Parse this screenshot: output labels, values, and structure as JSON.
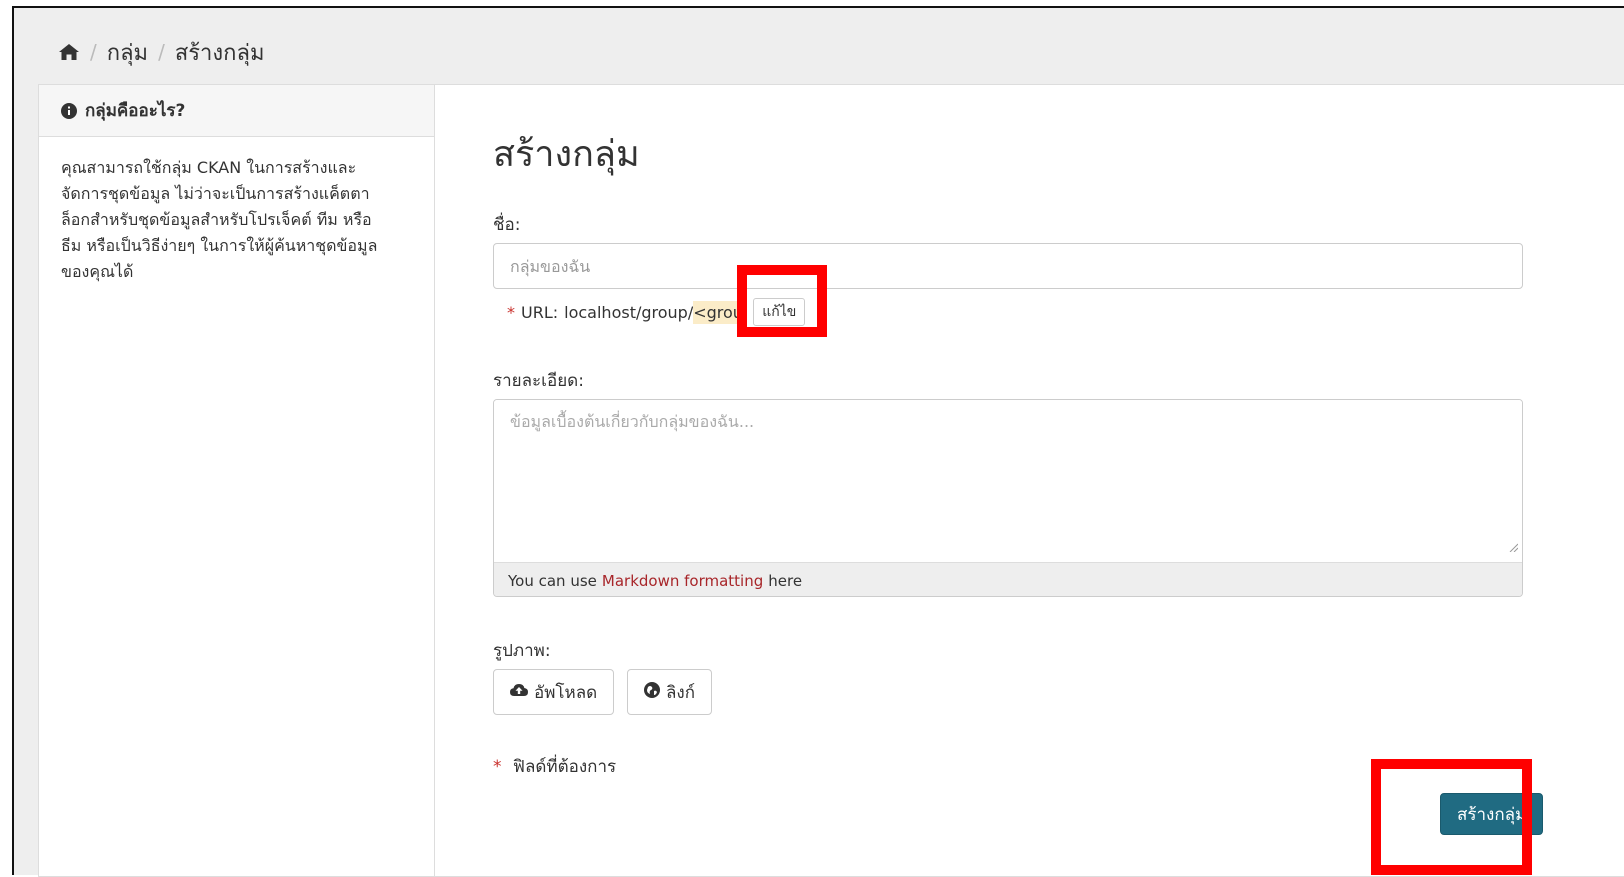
{
  "breadcrumb": {
    "home_icon": "home-icon",
    "sep": "/",
    "items": [
      "กลุ่ม",
      "สร้างกลุ่ม"
    ]
  },
  "sidebar": {
    "title": "กลุ่มคืออะไร?",
    "icon": "info-circle-icon",
    "text": "คุณสามารถใช้กลุ่ม CKAN ในการสร้างและจัดการชุดข้อมูล ไม่ว่าจะเป็นการสร้างแค็ตตาล็อกสำหรับชุดข้อมูลสำหรับโปรเจ็คต์ ทีม หรือธีม หรือเป็นวิธีง่ายๆ ในการให้ผู้ค้นหาชุดข้อมูลของคุณได้"
  },
  "form": {
    "title": "สร้างกลุ่ม",
    "name_label": "ชื่อ:",
    "name_placeholder": "กลุ่มของฉัน",
    "name_value": "",
    "url_required_mark": "*",
    "url_label": "URL:",
    "url_prefix": "localhost/group/",
    "url_slug": "<group>",
    "edit_label": "แก้ไข",
    "desc_label": "รายละเอียด:",
    "desc_placeholder": "ข้อมูลเบื้องต้นเกี่ยวกับกลุ่มของฉัน...",
    "markdown_prefix": "You can use",
    "markdown_link": "Markdown formatting",
    "markdown_suffix": "here",
    "image_label": "รูปภาพ:",
    "upload_label": "อัพโหลด",
    "link_label": "ลิงก์",
    "required_mark": "*",
    "required_note": "ฟิลด์ที่ต้องการ",
    "submit_label": "สร้างกลุ่ม"
  },
  "colors": {
    "accent": "#206b82",
    "link": "#a8262a",
    "required": "#c9302c",
    "annotation": "#ff0000"
  }
}
